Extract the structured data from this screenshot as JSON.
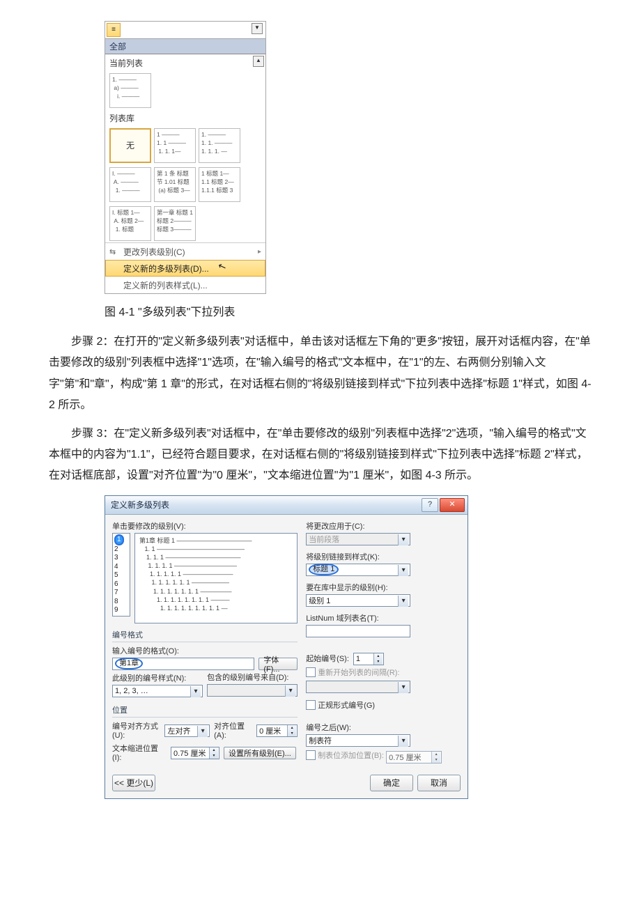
{
  "gallery": {
    "header_all": "全部",
    "section_current": "当前列表",
    "section_library": "列表库",
    "tile_current": "1. ———\n a) ———\n   i. ———",
    "tile_none": "无",
    "tile_b": "1 ———\n1. 1 ———\n 1. 1. 1—",
    "tile_c": "1. ———\n1. 1. ———\n1. 1. 1. —",
    "tile_d": "I. ———\n A. ———\n  1. ———",
    "tile_e": "第 1 条 标题\n节 1.01 标题\n (a) 标题 3—",
    "tile_f": "1 标题 1—\n1.1 标题 2—\n1.1.1 标题 3",
    "tile_g": "I. 标题 1—\n A. 标题 2—\n  1. 标题",
    "tile_h": "第一章 标题 1\n标题 2———\n标题 3———",
    "footer_change": "更改列表级别(C)",
    "footer_define_ml": "定义新的多级列表(D)...",
    "footer_define_style": "定义新的列表样式(L)..."
  },
  "caption_4_1": "图 4-1 \"多级列表\"下拉列表",
  "para_step2": "步骤 2：在打开的\"定义新多级列表\"对话框中，单击该对话框左下角的\"更多\"按钮，展开对话框内容，在\"单击要修改的级别\"列表框中选择\"1\"选项，在\"输入编号的格式\"文本框中，在\"1\"的左、右两侧分别输入文字\"第\"和\"章\"，构成\"第 1 章\"的形式，在对话框右侧的\"将级别链接到样式\"下拉列表中选择\"标题 1\"样式，如图 4-2 所示。",
  "para_step3": "步骤 3：在\"定义新多级列表\"对话框中，在\"单击要修改的级别\"列表框中选择\"2\"选项，\"输入编号的格式\"文本框中的内容为\"1.1\"，已经符合题目要求，在对话框右侧的\"将级别链接到样式\"下拉列表中选择\"标题 2\"样式，在对话框底部，设置\"对齐位置\"为\"0 厘米\"，\"文本缩进位置\"为\"1 厘米\"，如图 4-3 所示。",
  "dialog": {
    "title": "定义新多级列表",
    "label_click_level": "单击要修改的级别(V):",
    "levels": [
      "1",
      "2",
      "3",
      "4",
      "5",
      "6",
      "7",
      "8",
      "9"
    ],
    "selected_level": "1",
    "preview_text": "第1章 标题 1 ————————————\n   1. 1 ——————————————\n    1. 1. 1 ————————————\n     1. 1. 1. 1 ——————————\n      1. 1. 1. 1. 1 ————————\n       1. 1. 1. 1. 1. 1 ——————\n        1. 1. 1. 1. 1. 1. 1 —————\n          1. 1. 1. 1. 1. 1. 1. 1 ———\n            1. 1. 1. 1. 1. 1. 1. 1. 1 —",
    "group_number_format": "编号格式",
    "label_enter_format": "输入编号的格式(O):",
    "enter_format_value": "第1章",
    "btn_font": "字体(F)...",
    "label_num_style": "此级别的编号样式(N):",
    "num_style_value": "1, 2, 3, …",
    "label_include_from": "包含的级别编号来自(D):",
    "group_position": "位置",
    "label_num_align": "编号对齐方式(U):",
    "num_align_value": "左对齐",
    "label_align_at": "对齐位置(A):",
    "align_at_value": "0 厘米",
    "label_indent_at": "文本缩进位置(I):",
    "indent_at_value": "0.75 厘米",
    "btn_set_all": "设置所有级别(E)...",
    "label_apply_to": "将更改应用于(C):",
    "apply_to_value": "当前段落",
    "label_link_style": "将级别链接到样式(K):",
    "link_style_value": "标题 1",
    "label_show_in_lib": "要在库中显示的级别(H):",
    "show_in_lib_value": "级别 1",
    "label_listnum": "ListNum 域列表名(T):",
    "listnum_value": "",
    "label_start_at": "起始编号(S):",
    "start_at_value": "1",
    "label_restart": "重新开始列表的间隔(R):",
    "label_legal": "正规形式编号(G)",
    "label_follow": "编号之后(W):",
    "follow_value": "制表符",
    "label_tab_add": "制表位添加位置(B):",
    "tab_add_value": "0.75 厘米",
    "btn_less": "<< 更少(L)",
    "btn_ok": "确定",
    "btn_cancel": "取消"
  }
}
